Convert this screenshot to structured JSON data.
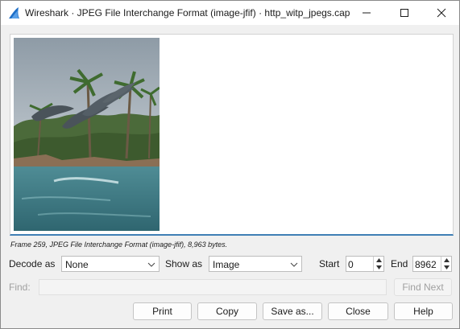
{
  "window": {
    "title": "Wireshark · JPEG File Interchange Format (image-jfif) · http_witp_jpegs.cap",
    "icons": {
      "app": "wireshark-fin-icon",
      "minimize": "minimize-icon",
      "maximize": "maximize-icon",
      "close": "close-icon"
    }
  },
  "status": "Frame 259, JPEG File Interchange Format (image-jfif), 8,963 bytes.",
  "controls": {
    "decode_as_label": "Decode as",
    "decode_as_value": "None",
    "show_as_label": "Show as",
    "show_as_value": "Image",
    "start_label": "Start",
    "start_value": "0",
    "end_label": "End",
    "end_value": "8962"
  },
  "find": {
    "label": "Find:",
    "value": "",
    "next_button": "Find Next"
  },
  "buttons": {
    "print": "Print",
    "copy": "Copy",
    "save_as": "Save as...",
    "close": "Close",
    "help": "Help"
  },
  "colors": {
    "accent": "#3f7fb5",
    "window_bg": "#f0f0f0",
    "wireshark_blue": "#1e6fc8"
  }
}
